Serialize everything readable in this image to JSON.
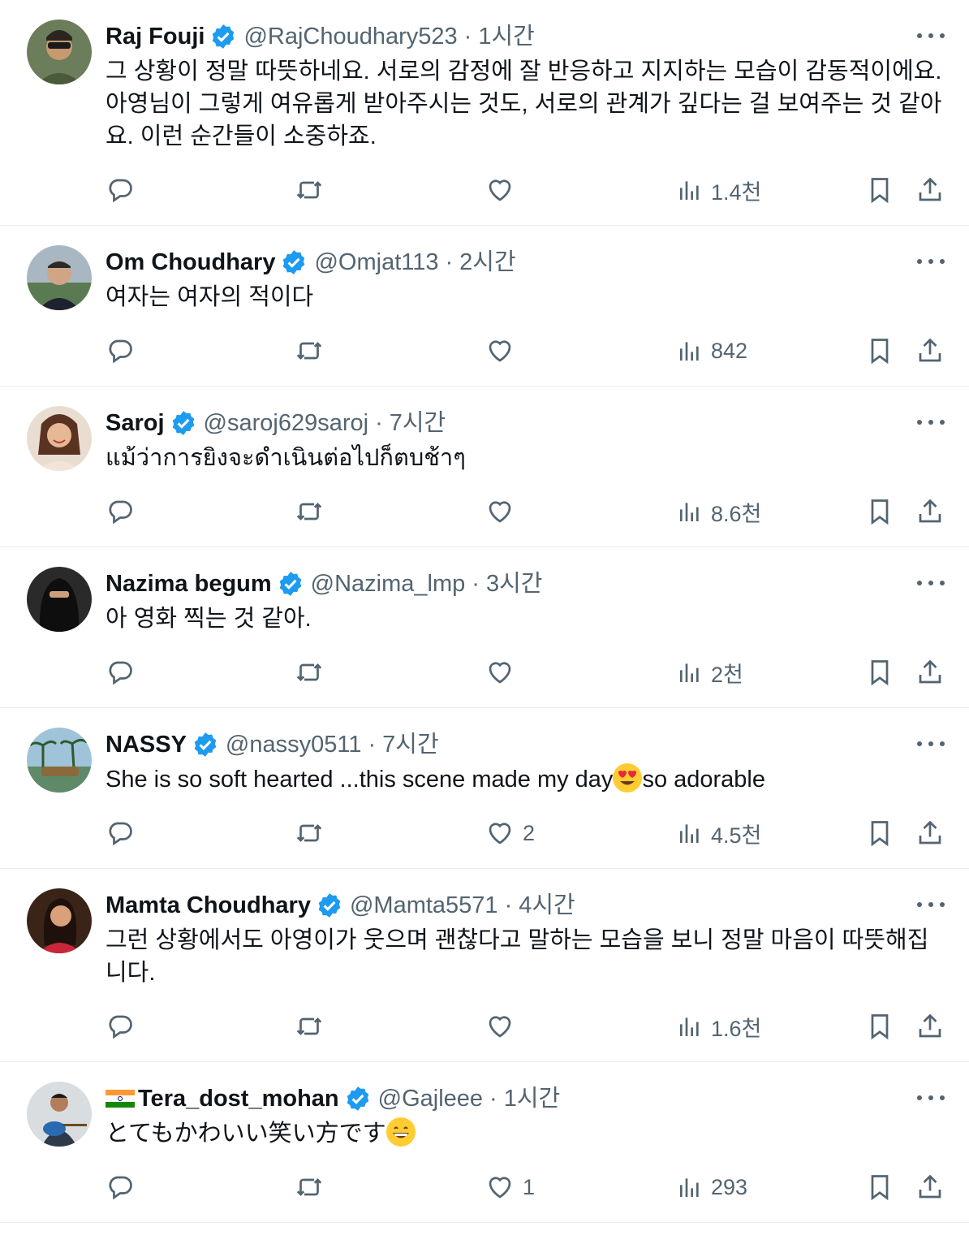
{
  "colors": {
    "verified": "#1d9bf0",
    "muted": "#536471",
    "text": "#0f1419"
  },
  "tweets": [
    {
      "avatar": "avatar-sunglasses-man",
      "name": "Raj Fouji",
      "handle": "@RajChoudhary523",
      "dot": "·",
      "time": "1시간",
      "text": "그 상황이 정말 따뜻하네요. 서로의 감정에 잘 반응하고 지지하는 모습이 감동적이에요. 아영님이 그렇게 여유롭게 받아주시는 것도, 서로의 관계가 깊다는 걸 보여주는 것 같아요. 이런 순간들이 소중하죠.",
      "likes": "",
      "views": "1.4천"
    },
    {
      "avatar": "avatar-man-cap",
      "name": "Om Choudhary",
      "handle": "@Omjat113",
      "dot": "·",
      "time": "2시간",
      "text": "여자는 여자의 적이다",
      "likes": "",
      "views": "842"
    },
    {
      "avatar": "avatar-woman-smiling",
      "name": "Saroj",
      "handle": "@saroj629saroj",
      "dot": "·",
      "time": "7시간",
      "text": "แม้ว่าการยิงจะดำเนินต่อไปก็ตบช้าๆ",
      "likes": "",
      "views": "8.6천"
    },
    {
      "avatar": "avatar-niqab",
      "name": "Nazima begum",
      "handle": "@Nazima_lmp",
      "dot": "·",
      "time": "3시간",
      "text": "아 영화 찍는 것 같아.",
      "likes": "",
      "views": "2천"
    },
    {
      "avatar": "avatar-palm-trees-boat",
      "name": "NASSY",
      "handle": "@nassy0511",
      "dot": "·",
      "time": "7시간",
      "text_before": "She is so soft hearted ...this scene made my day",
      "emoji": "heart-eyes-emoji",
      "text_after": "so adorable",
      "likes": "2",
      "views": "4.5천"
    },
    {
      "avatar": "avatar-woman-red-dress",
      "name": "Mamta Choudhary",
      "handle": "@Mamta5571",
      "dot": "·",
      "time": "4시간",
      "text": "그런 상황에서도 아영이가 웃으며 괜찮다고 말하는 모습을 보니 정말 마음이 따뜻해집니다.",
      "likes": "",
      "views": "1.6천"
    },
    {
      "avatar": "avatar-guitar-man",
      "flag": "india-flag-icon",
      "name": "Tera_dost_mohan",
      "handle": "@Gajleee",
      "dot": "·",
      "time": "1시간",
      "text_before": "とてもかわいい笑い方です",
      "emoji": "grinning-emoji",
      "text_after": "",
      "likes": "1",
      "views": "293"
    }
  ]
}
